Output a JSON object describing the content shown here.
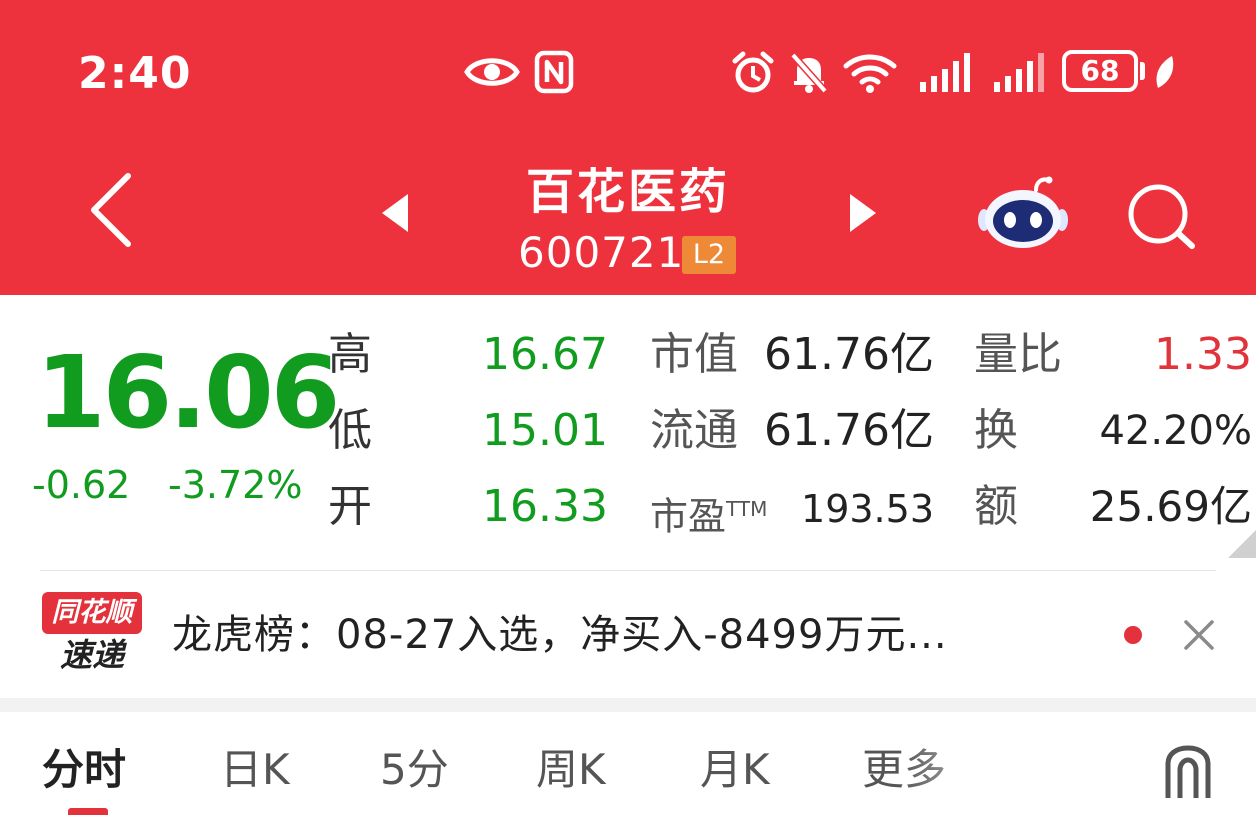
{
  "status_bar": {
    "time": "2:40",
    "battery": "68",
    "icons": [
      "eye-icon",
      "nfc-icon",
      "alarm-icon",
      "mute-icon",
      "wifi-icon",
      "signal-icon",
      "signal-icon",
      "battery-icon",
      "leaf-icon"
    ]
  },
  "header": {
    "stock_name": "百花医药",
    "stock_code": "600721",
    "level_badge": "L2",
    "icons": [
      "back-icon",
      "prev-stock-icon",
      "next-stock-icon",
      "robot-assistant-icon",
      "search-icon"
    ]
  },
  "quote": {
    "price": "16.06",
    "change": "-0.62",
    "change_pct": "-3.72%",
    "rows": [
      {
        "label": "高",
        "value": "16.67"
      },
      {
        "label": "低",
        "value": "15.01"
      },
      {
        "label": "开",
        "value": "16.33"
      }
    ],
    "market_cap_label": "市值",
    "market_cap": "61.76亿",
    "float_cap_label": "流通",
    "float_cap": "61.76亿",
    "pe_label": "市盈",
    "pe_sup": "TTM",
    "pe": "193.53",
    "volume_ratio_label": "量比",
    "volume_ratio": "1.33",
    "turnover_label": "换",
    "turnover": "42.20%",
    "amount_label": "额",
    "amount": "25.69亿"
  },
  "news": {
    "logo_top": "同花顺",
    "logo_bottom": "速递",
    "text": "龙虎榜：08-27入选，净买入-8499万元..."
  },
  "tabs": [
    {
      "label": "分时"
    },
    {
      "label": "日K"
    },
    {
      "label": "5分"
    },
    {
      "label": "周K"
    },
    {
      "label": "月K"
    },
    {
      "label": "更多"
    }
  ],
  "colors": {
    "header_red": "#ee323d",
    "down_green": "#119c1f",
    "up_red": "#e0333c",
    "badge_orange": "#ee8a37"
  }
}
